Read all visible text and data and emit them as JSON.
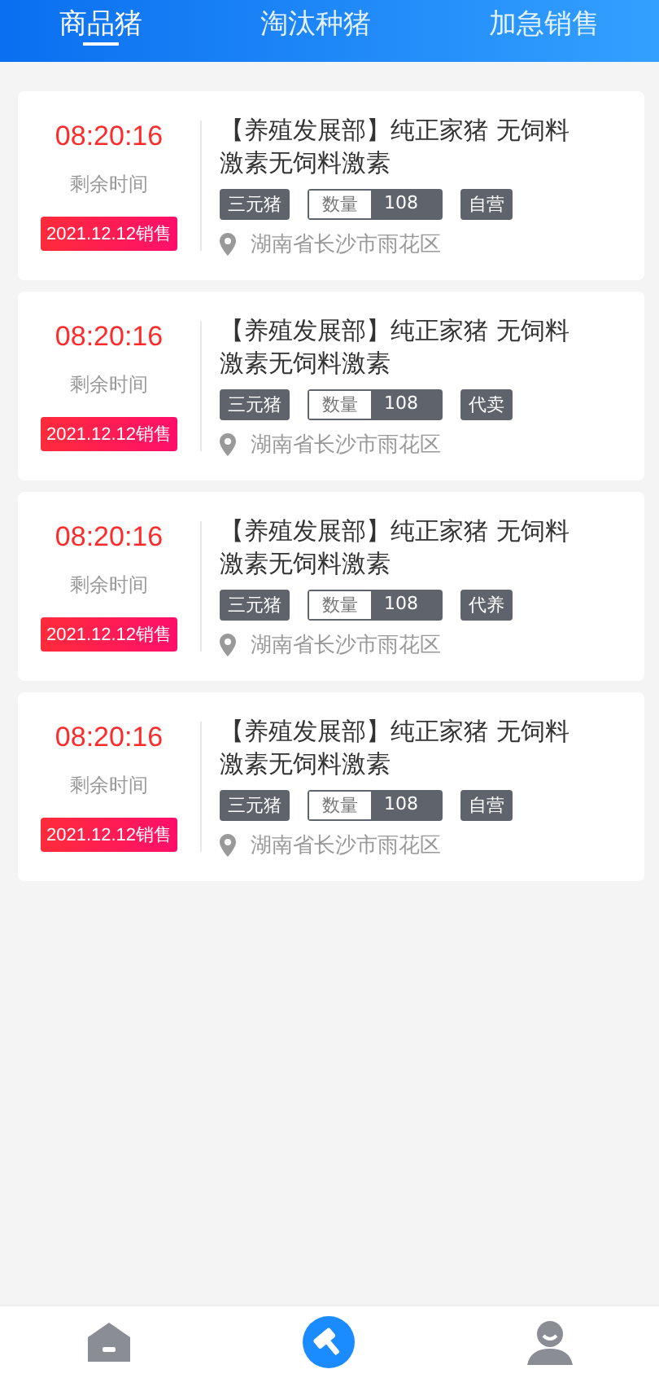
{
  "tabs": [
    {
      "label": "商品猪",
      "selected": true
    },
    {
      "label": "淘汰种猪",
      "selected": false
    },
    {
      "label": "加急销售",
      "selected": false
    }
  ],
  "listings": [
    {
      "countdown": "08:20:16",
      "countdown_label": "剩余时间",
      "sale_date": "2021.12.12销售",
      "title": "【养殖发展部】纯正家猪 无饲料激素无饲料激素",
      "breed": "三元猪",
      "quantity_label": "数量",
      "quantity": "108",
      "seller_type": "自营",
      "location": "湖南省长沙市雨花区"
    },
    {
      "countdown": "08:20:16",
      "countdown_label": "剩余时间",
      "sale_date": "2021.12.12销售",
      "title": "【养殖发展部】纯正家猪 无饲料激素无饲料激素",
      "breed": "三元猪",
      "quantity_label": "数量",
      "quantity": "108",
      "seller_type": "代卖",
      "location": "湖南省长沙市雨花区"
    },
    {
      "countdown": "08:20:16",
      "countdown_label": "剩余时间",
      "sale_date": "2021.12.12销售",
      "title": "【养殖发展部】纯正家猪 无饲料激素无饲料激素",
      "breed": "三元猪",
      "quantity_label": "数量",
      "quantity": "108",
      "seller_type": "代养",
      "location": "湖南省长沙市雨花区"
    },
    {
      "countdown": "08:20:16",
      "countdown_label": "剩余时间",
      "sale_date": "2021.12.12销售",
      "title": "【养殖发展部】纯正家猪 无饲料激素无饲料激素",
      "breed": "三元猪",
      "quantity_label": "数量",
      "quantity": "108",
      "seller_type": "自营",
      "location": "湖南省长沙市雨花区"
    }
  ],
  "bottom_nav": [
    {
      "selected": false
    },
    {
      "selected": true
    },
    {
      "selected": false
    }
  ]
}
